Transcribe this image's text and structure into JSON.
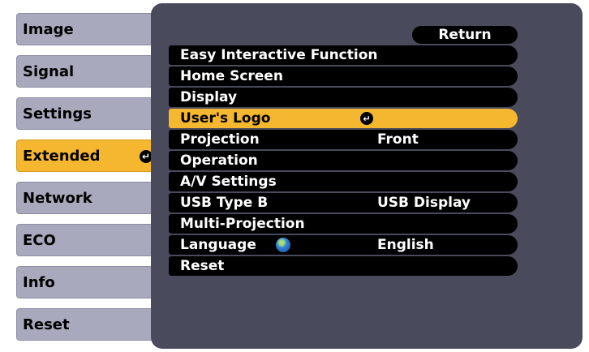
{
  "sidebar": {
    "tabs": [
      {
        "label": "Image"
      },
      {
        "label": "Signal"
      },
      {
        "label": "Settings"
      },
      {
        "label": "Extended",
        "active": true
      },
      {
        "label": "Network"
      },
      {
        "label": "ECO"
      },
      {
        "label": "Info"
      },
      {
        "label": "Reset"
      }
    ],
    "enter_symbol": "↵"
  },
  "panel": {
    "return_label": "Return",
    "items": [
      {
        "label": "Easy Interactive Function",
        "value": ""
      },
      {
        "label": "Home Screen",
        "value": ""
      },
      {
        "label": "Display",
        "value": ""
      },
      {
        "label": "User's Logo",
        "value": ""
      },
      {
        "label": "Projection",
        "value": "Front"
      },
      {
        "label": "Operation",
        "value": ""
      },
      {
        "label": "A/V Settings",
        "value": ""
      },
      {
        "label": "USB Type B",
        "value": "USB Display"
      },
      {
        "label": "Multi-Projection",
        "value": ""
      },
      {
        "label": "Language",
        "value": "English"
      },
      {
        "label": "Reset",
        "value": ""
      }
    ]
  },
  "colors": {
    "accent": "#f5b630",
    "tab": "#a8a9bd",
    "panel": "#494a5c"
  }
}
